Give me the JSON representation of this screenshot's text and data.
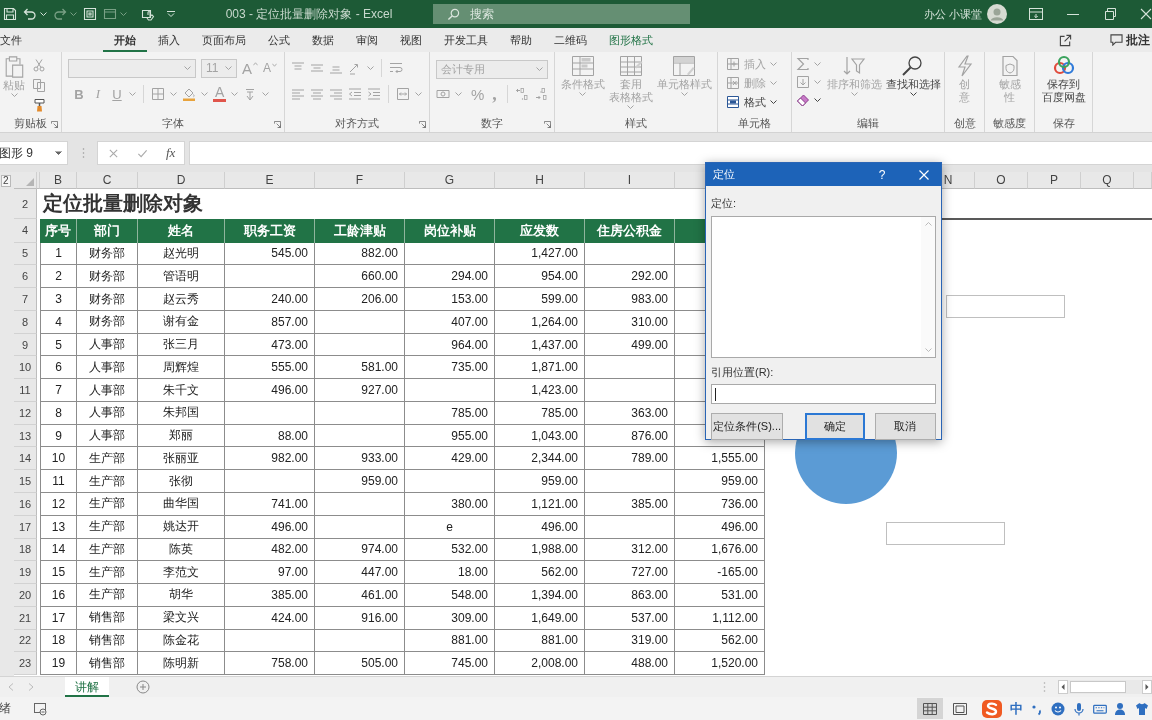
{
  "title_bar": {
    "title": "003 - 定位批量删除对象 - Excel",
    "search_placeholder": "搜索",
    "user_name": "办公 小课堂"
  },
  "ribbon": {
    "tabs": [
      {
        "label": "文件",
        "selected": false,
        "kind": "standard"
      },
      {
        "label": "开始",
        "selected": true,
        "kind": "standard"
      },
      {
        "label": "插入",
        "selected": false,
        "kind": "standard"
      },
      {
        "label": "页面布局",
        "selected": false,
        "kind": "standard"
      },
      {
        "label": "公式",
        "selected": false,
        "kind": "standard"
      },
      {
        "label": "数据",
        "selected": false,
        "kind": "standard"
      },
      {
        "label": "审阅",
        "selected": false,
        "kind": "standard"
      },
      {
        "label": "视图",
        "selected": false,
        "kind": "standard"
      },
      {
        "label": "开发工具",
        "selected": false,
        "kind": "standard"
      },
      {
        "label": "帮助",
        "selected": false,
        "kind": "standard"
      },
      {
        "label": "二维码",
        "selected": false,
        "kind": "standard"
      },
      {
        "label": "图形格式",
        "selected": false,
        "kind": "contextual"
      }
    ],
    "comment_button": "批注",
    "clipboard": {
      "label": "剪贴板",
      "paste": {
        "label": "粘贴",
        "disabled": true
      }
    },
    "font": {
      "label": "字体",
      "disabled": true,
      "size": "11",
      "grow": "A",
      "shrink": "A",
      "bold": "B",
      "italic": "I",
      "underline": "U",
      "font_color": "A"
    },
    "alignment": {
      "label": "对齐方式",
      "disabled": true
    },
    "number": {
      "label": "数字",
      "disabled": true,
      "format": "会计专用",
      "percent": "%",
      "comma": ","
    },
    "styles": {
      "label": "样式",
      "buttons": [
        {
          "label": "条件格式",
          "disabled": true
        },
        {
          "label": "套用表格格式",
          "disabled": true
        },
        {
          "label": "单元格样式",
          "disabled": true
        }
      ]
    },
    "cells": {
      "label": "单元格",
      "buttons": [
        {
          "label": "插入",
          "disabled": true
        },
        {
          "label": "删除",
          "disabled": true
        },
        {
          "label": "格式",
          "disabled": false
        }
      ]
    },
    "editing": {
      "label": "编辑",
      "buttons": [
        {
          "label": "排序和筛选",
          "disabled": true
        },
        {
          "label": "查找和选择",
          "disabled": false
        }
      ]
    },
    "ideas": {
      "label": "创意",
      "button": "创意",
      "disabled": true
    },
    "sensitivity": {
      "label": "敏感度",
      "button": "敏感性",
      "disabled": true
    },
    "save": {
      "label": "保存",
      "button": "保存到百度网盘",
      "disabled": false
    }
  },
  "formula_bar": {
    "name_box": "图形 9",
    "function_button": "fx"
  },
  "sheet": {
    "outline_button": "2",
    "column_headers": [
      "B",
      "C",
      "D",
      "E",
      "F",
      "G",
      "H",
      "I"
    ],
    "right_column_headers": [
      "N",
      "O",
      "P",
      "Q"
    ],
    "title_row": "2",
    "title": "定位批量删除对象",
    "header_row": "4",
    "headers": [
      "序号",
      "部门",
      "姓名",
      "职务工资",
      "工龄津贴",
      "岗位补贴",
      "应发数",
      "住房公积金"
    ],
    "rows": [
      {
        "number": "5",
        "cells": [
          "1",
          "财务部",
          "赵光明",
          "545.00",
          "882.00",
          null,
          "1,427.00",
          null,
          null
        ]
      },
      {
        "number": "6",
        "cells": [
          "2",
          "财务部",
          "管语明",
          null,
          "660.00",
          "294.00",
          "954.00",
          "292.00",
          null
        ]
      },
      {
        "number": "7",
        "cells": [
          "3",
          "财务部",
          "赵云秀",
          "240.00",
          "206.00",
          "153.00",
          "599.00",
          "983.00",
          null
        ]
      },
      {
        "number": "8",
        "cells": [
          "4",
          "财务部",
          "谢有金",
          "857.00",
          null,
          "407.00",
          "1,264.00",
          "310.00",
          null
        ]
      },
      {
        "number": "9",
        "cells": [
          "5",
          "人事部",
          "张三月",
          "473.00",
          null,
          "964.00",
          "1,437.00",
          "499.00",
          null
        ]
      },
      {
        "number": "10",
        "cells": [
          "6",
          "人事部",
          "周辉煌",
          "555.00",
          "581.00",
          "735.00",
          "1,871.00",
          null,
          null
        ]
      },
      {
        "number": "11",
        "cells": [
          "7",
          "人事部",
          "朱千文",
          "496.00",
          "927.00",
          null,
          "1,423.00",
          null,
          null
        ]
      },
      {
        "number": "12",
        "cells": [
          "8",
          "人事部",
          "朱邦国",
          null,
          null,
          "785.00",
          "785.00",
          "363.00",
          null
        ]
      },
      {
        "number": "13",
        "cells": [
          "9",
          "人事部",
          "郑丽",
          "88.00",
          null,
          "955.00",
          "1,043.00",
          "876.00",
          null
        ]
      },
      {
        "number": "14",
        "cells": [
          "10",
          "生产部",
          "张丽亚",
          "982.00",
          "933.00",
          "429.00",
          "2,344.00",
          "789.00",
          "1,555.00"
        ]
      },
      {
        "number": "15",
        "cells": [
          "11",
          "生产部",
          "张彻",
          null,
          "959.00",
          null,
          "959.00",
          null,
          "959.00"
        ]
      },
      {
        "number": "16",
        "cells": [
          "12",
          "生产部",
          "曲华国",
          "741.00",
          null,
          "380.00",
          "1,121.00",
          "385.00",
          "736.00"
        ]
      },
      {
        "number": "17",
        "cells": [
          "13",
          "生产部",
          "姚达开",
          "496.00",
          null,
          {
            "text": "e",
            "kind": "text"
          },
          "496.00",
          null,
          "496.00"
        ]
      },
      {
        "number": "18",
        "cells": [
          "14",
          "生产部",
          "陈英",
          "482.00",
          "974.00",
          "532.00",
          "1,988.00",
          "312.00",
          "1,676.00"
        ]
      },
      {
        "number": "19",
        "cells": [
          "15",
          "生产部",
          "李范文",
          "97.00",
          "447.00",
          "18.00",
          "562.00",
          "727.00",
          "-165.00"
        ]
      },
      {
        "number": "20",
        "cells": [
          "16",
          "生产部",
          "胡华",
          "385.00",
          "461.00",
          "548.00",
          "1,394.00",
          "863.00",
          "531.00"
        ]
      },
      {
        "number": "21",
        "cells": [
          "17",
          "销售部",
          "梁文兴",
          "424.00",
          "916.00",
          "309.00",
          "1,649.00",
          "537.00",
          "1,112.00"
        ]
      },
      {
        "number": "22",
        "cells": [
          "18",
          "销售部",
          "陈金花",
          null,
          null,
          "881.00",
          "881.00",
          "319.00",
          "562.00"
        ]
      },
      {
        "number": "23",
        "cells": [
          "19",
          "销售部",
          "陈明新",
          "758.00",
          "505.00",
          "745.00",
          "2,008.00",
          "488.00",
          "1,520.00"
        ]
      }
    ],
    "shapes": [
      {
        "kind": "line"
      },
      {
        "kind": "rectangle"
      },
      {
        "kind": "oval"
      },
      {
        "kind": "rectangle"
      }
    ]
  },
  "dialog": {
    "title": "定位",
    "help_button": "?",
    "list_label": "定位:",
    "reference_label": "引用位置(R):",
    "buttons": [
      {
        "label": "定位条件(S)...",
        "kind": "normal"
      },
      {
        "label": "确定",
        "kind": "default"
      },
      {
        "label": "取消",
        "kind": "normal"
      }
    ]
  },
  "sheet_tabs": {
    "tabs": [
      {
        "label": "讲解",
        "selected": true
      }
    ]
  },
  "status_bar": {
    "text": "绪",
    "views": [
      {
        "kind": "normal",
        "selected": true
      },
      {
        "kind": "page_layout",
        "selected": false
      }
    ],
    "ime_mode": "中"
  }
}
